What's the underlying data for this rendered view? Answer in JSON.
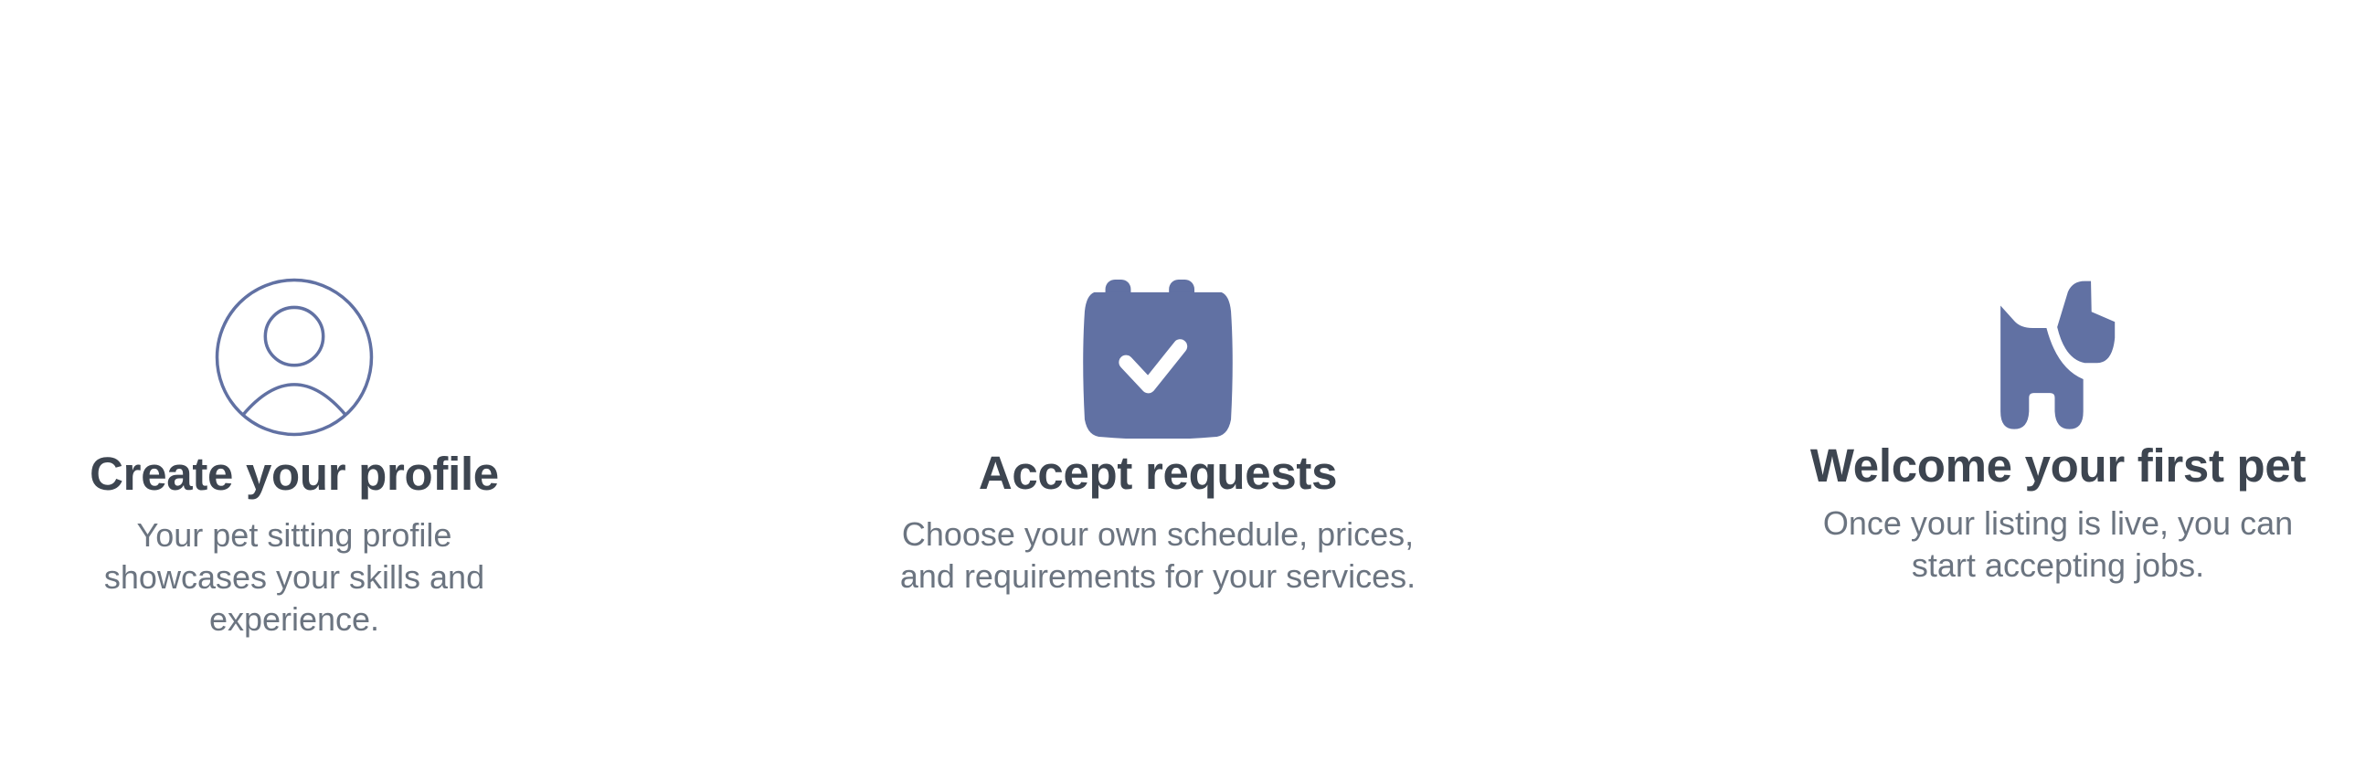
{
  "accent_color": "#6171a3",
  "steps": [
    {
      "icon": "user-circle-icon",
      "title": "Create your profile",
      "body_lines": [
        "Your pet sitting profile",
        "showcases your skills and",
        "experience."
      ]
    },
    {
      "icon": "calendar-check-icon",
      "title": "Accept requests",
      "body_lines": [
        "Choose your own schedule, prices,",
        "and requirements for your services."
      ]
    },
    {
      "icon": "dog-icon",
      "title": "Welcome your first pet",
      "body_lines": [
        "Once your listing is live, you can",
        "start accepting jobs."
      ]
    }
  ]
}
